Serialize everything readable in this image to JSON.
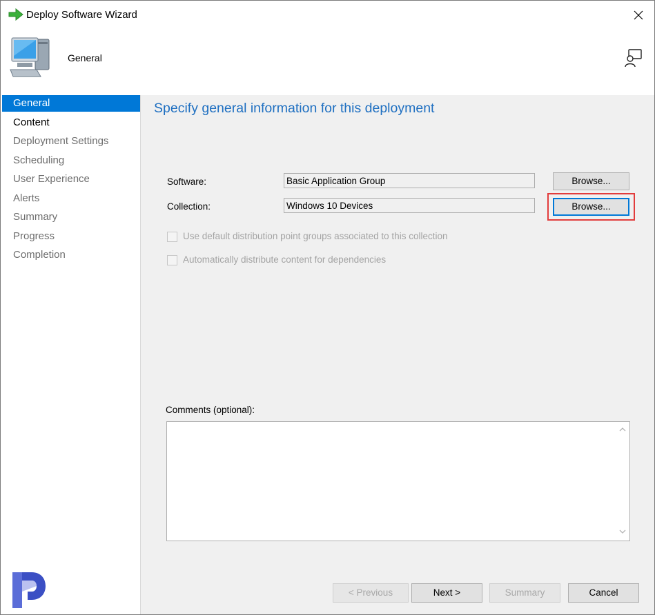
{
  "window": {
    "title": "Deploy Software Wizard"
  },
  "header": {
    "title": "General"
  },
  "sidebar": {
    "items": [
      {
        "label": "General",
        "state": "active"
      },
      {
        "label": "Content",
        "state": "current"
      },
      {
        "label": "Deployment Settings",
        "state": "normal"
      },
      {
        "label": "Scheduling",
        "state": "normal"
      },
      {
        "label": "User Experience",
        "state": "normal"
      },
      {
        "label": "Alerts",
        "state": "normal"
      },
      {
        "label": "Summary",
        "state": "normal"
      },
      {
        "label": "Progress",
        "state": "normal"
      },
      {
        "label": "Completion",
        "state": "normal"
      }
    ]
  },
  "main": {
    "heading": "Specify general information for this deployment",
    "software": {
      "label": "Software:",
      "value": "Basic Application Group",
      "browse_label": "Browse..."
    },
    "collection": {
      "label": "Collection:",
      "value": "Windows 10 Devices",
      "browse_label": "Browse..."
    },
    "options": [
      {
        "label": "Use default distribution point groups associated to this collection",
        "checked": false,
        "enabled": false
      },
      {
        "label": "Automatically distribute content for dependencies",
        "checked": false,
        "enabled": false
      }
    ],
    "comments": {
      "label": "Comments (optional):",
      "value": ""
    }
  },
  "footer": {
    "previous_label": "< Previous",
    "next_label": "Next >",
    "summary_label": "Summary",
    "cancel_label": "Cancel"
  },
  "colors": {
    "accent": "#0078d7",
    "heading": "#1e6fc1",
    "highlight": "#e23c3c"
  },
  "icons": [
    "green-arrow-icon",
    "close-icon",
    "computer-icon",
    "help-icon",
    "brand-logo"
  ]
}
